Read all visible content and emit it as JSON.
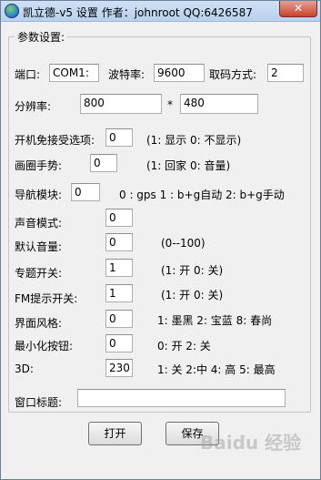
{
  "window": {
    "title": "凯立德-v5 设置  作者：johnroot  QQ:6426587",
    "close_glyph": "✕"
  },
  "group": {
    "legend": "参数设置:"
  },
  "port": {
    "label": "端口:",
    "value": "COM1:"
  },
  "baud": {
    "label": "波特率:",
    "value": "9600"
  },
  "fetch_mode": {
    "label": "取码方式:",
    "value": "2"
  },
  "resolution": {
    "label": "分辨率:",
    "width": "800",
    "separator": "*",
    "height": "480"
  },
  "settings": [
    {
      "label": "开机免接受选项:",
      "value": "0",
      "hint": "(1: 显示 0: 不显示)"
    },
    {
      "label": "画圈手势:",
      "value": "0",
      "hint": "(1: 回家 0: 音量)"
    },
    {
      "label": "导航模块:",
      "value": "0",
      "hint": "0 : gps  1 : b+g自动  2: b+g手动"
    },
    {
      "label": "声音模式:",
      "value": "0",
      "hint": ""
    },
    {
      "label": "默认音量:",
      "value": "0",
      "hint": "(0--100)"
    },
    {
      "label": "专题开关:",
      "value": "1",
      "hint": "(1: 开 0: 关)"
    },
    {
      "label": "FM提示开关:",
      "value": "1",
      "hint": "(1: 开 0: 关)"
    },
    {
      "label": "界面风格:",
      "value": "0",
      "hint": "1: 墨黑  2: 宝蓝  8: 春尚"
    },
    {
      "label": "最小化按钮:",
      "value": "0",
      "hint": "0: 开 2: 关"
    },
    {
      "label": "3D:",
      "value": "230",
      "hint": "1: 关 2:中 4: 高 5: 最高"
    }
  ],
  "window_title_field": {
    "label": "窗口标题:",
    "value": ""
  },
  "buttons": {
    "open": "打开",
    "save": "保存"
  },
  "watermark": "Baidu 经验"
}
